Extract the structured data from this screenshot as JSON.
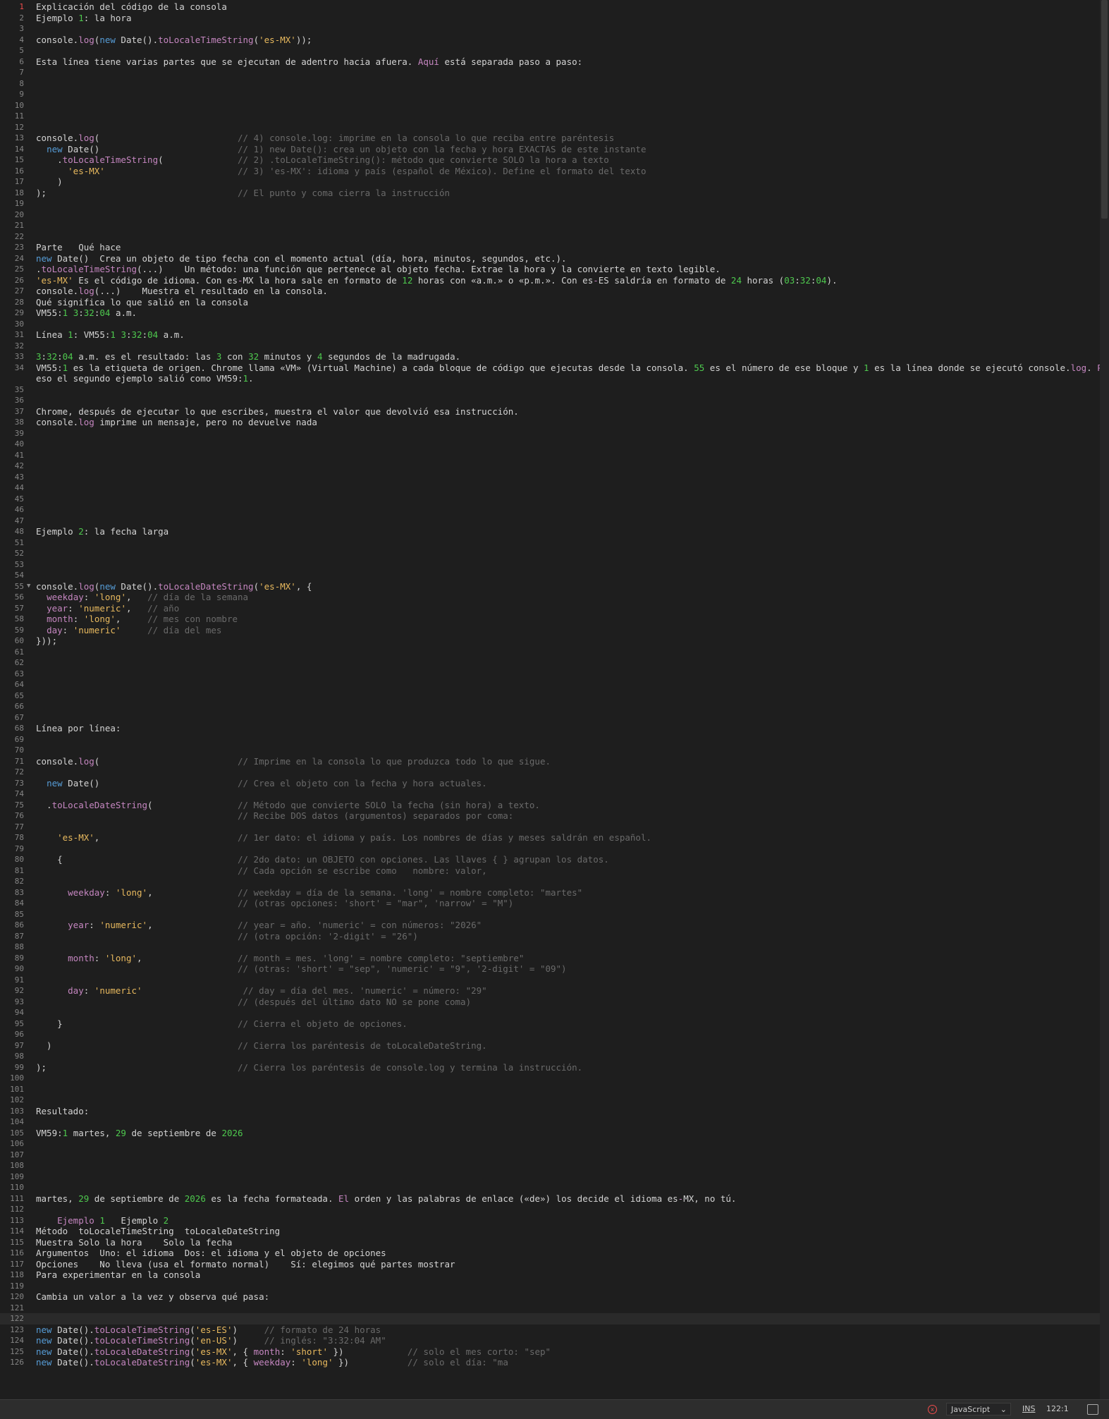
{
  "editor": {
    "cursor_line": 122,
    "lines": [
      {
        "n": "1",
        "html": "Explicación del código de la consola"
      },
      {
        "n": "2",
        "html": "Ejemplo <span class='num'>1</span>: la hora"
      },
      {
        "n": "3",
        "html": ""
      },
      {
        "n": "4",
        "html": "console.<span class='f'>log</span>(<span class='k'>new</span> Date().<span class='f'>toLocaleTimeString</span>(<span class='sq'>'es-MX'</span>));"
      },
      {
        "n": "5",
        "html": ""
      },
      {
        "n": "6",
        "html": "Esta línea tiene varias partes que se ejecutan de adentro hacia afuera. <span class='p'>Aquí</span> está separada paso a paso:"
      },
      {
        "n": "7",
        "html": ""
      },
      {
        "n": "8",
        "html": ""
      },
      {
        "n": "9",
        "html": ""
      },
      {
        "n": "10",
        "html": ""
      },
      {
        "n": "11",
        "html": ""
      },
      {
        "n": "12",
        "html": ""
      },
      {
        "n": "13",
        "html": "console.<span class='f'>log</span>(                          <span class='c'>// 4) console.log: imprime en la consola lo que reciba entre paréntesis</span>"
      },
      {
        "n": "14",
        "html": "  <span class='k'>new</span> Date()                          <span class='c'>// 1) new Date(): crea un objeto con la fecha y hora EXACTAS de este instante</span>"
      },
      {
        "n": "15",
        "html": "    .<span class='f'>toLocaleTimeString</span>(              <span class='c'>// 2) .toLocaleTimeString(): método que convierte SOLO la hora a texto</span>"
      },
      {
        "n": "16",
        "html": "      <span class='sq'>'es-MX'</span>                         <span class='c'>// 3) 'es-MX': idioma y país (español de México). Define el formato del texto</span>"
      },
      {
        "n": "17",
        "html": "    )"
      },
      {
        "n": "18",
        "html": ");                                    <span class='c'>// El punto y coma cierra la instrucción</span>"
      },
      {
        "n": "19",
        "html": ""
      },
      {
        "n": "20",
        "html": ""
      },
      {
        "n": "21",
        "html": ""
      },
      {
        "n": "22",
        "html": ""
      },
      {
        "n": "23",
        "html": "Parte   Qué hace"
      },
      {
        "n": "24",
        "html": "<span class='k'>new</span> Date()  Crea un objeto de tipo fecha con el momento actual (día, hora, minutos, segundos, etc.)."
      },
      {
        "n": "25",
        "html": ".<span class='f'>toLocaleTimeString</span>(...)    Un método: una función que pertenece al objeto fecha. Extrae la hora y la convierte en texto legible."
      },
      {
        "n": "26",
        "html": "<span class='sq'>'es-MX'</span> Es el código de idioma. Con es<span class='p'>-</span>MX la hora sale en formato de <span class='num'>12</span> horas con «a.m.» o «p.m.». Con es<span class='p'>-</span>ES saldría en formato de <span class='num'>24</span> horas (<span class='num'>03</span>:<span class='num'>32</span>:<span class='num'>04</span>)."
      },
      {
        "n": "27",
        "html": "console.<span class='f'>log</span>(...)    Muestra el resultado en la consola."
      },
      {
        "n": "28",
        "html": "Qué significa lo que salió en la consola"
      },
      {
        "n": "29",
        "html": "VM55:<span class='num'>1</span> <span class='num'>3</span>:<span class='num'>32</span>:<span class='num'>04</span> a.m."
      },
      {
        "n": "30",
        "html": ""
      },
      {
        "n": "31",
        "html": "Línea <span class='num'>1</span>: VM55:<span class='num'>1</span> <span class='num'>3</span>:<span class='num'>32</span>:<span class='num'>04</span> a.m."
      },
      {
        "n": "32",
        "html": ""
      },
      {
        "n": "33",
        "html": "<span class='num'>3</span>:<span class='num'>32</span>:<span class='num'>04</span> a.m. es el resultado: las <span class='num'>3</span> con <span class='num'>32</span> minutos y <span class='num'>4</span> segundos de la madrugada."
      },
      {
        "n": "34",
        "html": "VM55:<span class='num'>1</span> es la etiqueta de origen. Chrome llama «VM» (Virtual Machine) a cada bloque de código que ejecutas desde la consola. <span class='num'>55</span> es el número de ese bloque y <span class='num'>1</span> es la línea donde se ejecutó console.<span class='f'>log</span>. <span class='p'>Por</span>"
      },
      {
        "n": "",
        "html": "eso el segundo ejemplo salió como VM59:<span class='num'>1</span>."
      },
      {
        "n": "35",
        "html": ""
      },
      {
        "n": "36",
        "html": ""
      },
      {
        "n": "37",
        "html": "Chrome, después de ejecutar lo que escribes, muestra el valor que devolvió esa instrucción."
      },
      {
        "n": "38",
        "html": "console.<span class='f'>log</span> imprime un mensaje, pero no devuelve nada"
      },
      {
        "n": "39",
        "html": ""
      },
      {
        "n": "40",
        "html": ""
      },
      {
        "n": "41",
        "html": ""
      },
      {
        "n": "42",
        "html": ""
      },
      {
        "n": "43",
        "html": ""
      },
      {
        "n": "44",
        "html": ""
      },
      {
        "n": "45",
        "html": ""
      },
      {
        "n": "46",
        "html": ""
      },
      {
        "n": "47",
        "html": ""
      },
      {
        "n": "48",
        "html": "Ejemplo <span class='num'>2</span>: la fecha larga"
      },
      {
        "n": "51",
        "html": ""
      },
      {
        "n": "52",
        "html": ""
      },
      {
        "n": "53",
        "html": ""
      },
      {
        "n": "54",
        "html": ""
      },
      {
        "n": "55",
        "html": "console.<span class='f'>log</span>(<span class='k'>new</span> Date().<span class='f'>toLocaleDateString</span>(<span class='sq'>'es-MX'</span>, {"
      },
      {
        "n": "56",
        "html": "  <span class='f'>weekday</span>: <span class='sq'>'long'</span>,   <span class='c'>// día de la semana</span>"
      },
      {
        "n": "57",
        "html": "  <span class='f'>year</span>: <span class='sq'>'numeric'</span>,   <span class='c'>// año</span>"
      },
      {
        "n": "58",
        "html": "  <span class='f'>month</span>: <span class='sq'>'long'</span>,     <span class='c'>// mes con nombre</span>"
      },
      {
        "n": "59",
        "html": "  <span class='f'>day</span>: <span class='sq'>'numeric'</span>     <span class='c'>// día del mes</span>"
      },
      {
        "n": "60",
        "html": "}));"
      },
      {
        "n": "61",
        "html": ""
      },
      {
        "n": "62",
        "html": ""
      },
      {
        "n": "63",
        "html": ""
      },
      {
        "n": "64",
        "html": ""
      },
      {
        "n": "65",
        "html": ""
      },
      {
        "n": "66",
        "html": ""
      },
      {
        "n": "67",
        "html": ""
      },
      {
        "n": "68",
        "html": "Línea por línea:"
      },
      {
        "n": "69",
        "html": ""
      },
      {
        "n": "70",
        "html": ""
      },
      {
        "n": "71",
        "html": "console.<span class='f'>log</span>(                          <span class='c'>// Imprime en la consola lo que produzca todo lo que sigue.</span>"
      },
      {
        "n": "72",
        "html": ""
      },
      {
        "n": "73",
        "html": "  <span class='k'>new</span> Date()                          <span class='c'>// Crea el objeto con la fecha y hora actuales.</span>"
      },
      {
        "n": "74",
        "html": ""
      },
      {
        "n": "75",
        "html": "  .<span class='f'>toLocaleDateString</span>(                <span class='c'>// Método que convierte SOLO la fecha (sin hora) a texto.</span>"
      },
      {
        "n": "76",
        "html": "                                      <span class='c'>// Recibe DOS datos (argumentos) separados por coma:</span>"
      },
      {
        "n": "77",
        "html": ""
      },
      {
        "n": "78",
        "html": "    <span class='sq'>'es-MX'</span>,                          <span class='c'>// 1er dato: el idioma y país. Los nombres de días y meses saldrán en español.</span>"
      },
      {
        "n": "79",
        "html": ""
      },
      {
        "n": "80",
        "html": "    {                                 <span class='c'>// 2do dato: un OBJETO con opciones. Las llaves { } agrupan los datos.</span>"
      },
      {
        "n": "81",
        "html": "                                      <span class='c'>// Cada opción se escribe como   nombre: valor,</span>"
      },
      {
        "n": "82",
        "html": ""
      },
      {
        "n": "83",
        "html": "      <span class='f'>weekday</span>: <span class='sq'>'long'</span>,                <span class='c'>// weekday = día de la semana. 'long' = nombre completo: \"martes\"</span>"
      },
      {
        "n": "84",
        "html": "                                      <span class='c'>// (otras opciones: 'short' = \"mar\", 'narrow' = \"M\")</span>"
      },
      {
        "n": "85",
        "html": ""
      },
      {
        "n": "86",
        "html": "      <span class='f'>year</span>: <span class='sq'>'numeric'</span>,                <span class='c'>// year = año. 'numeric' = con números: \"2026\"</span>"
      },
      {
        "n": "87",
        "html": "                                      <span class='c'>// (otra opción: '2-digit' = \"26\")</span>"
      },
      {
        "n": "88",
        "html": ""
      },
      {
        "n": "89",
        "html": "      <span class='f'>month</span>: <span class='sq'>'long'</span>,                  <span class='c'>// month = mes. 'long' = nombre completo: \"septiembre\"</span>"
      },
      {
        "n": "90",
        "html": "                                      <span class='c'>// (otras: 'short' = \"sep\", 'numeric' = \"9\", '2-digit' = \"09\")</span>"
      },
      {
        "n": "91",
        "html": ""
      },
      {
        "n": "92",
        "html": "      <span class='f'>day</span>: <span class='sq'>'numeric'</span>                   <span class='c'>// day = día del mes. 'numeric' = número: \"29\"</span>"
      },
      {
        "n": "93",
        "html": "                                      <span class='c'>// (después del último dato NO se pone coma)</span>"
      },
      {
        "n": "94",
        "html": ""
      },
      {
        "n": "95",
        "html": "    }                                 <span class='c'>// Cierra el objeto de opciones.</span>"
      },
      {
        "n": "96",
        "html": ""
      },
      {
        "n": "97",
        "html": "  )                                   <span class='c'>// Cierra los paréntesis de toLocaleDateString.</span>"
      },
      {
        "n": "98",
        "html": ""
      },
      {
        "n": "99",
        "html": ");                                    <span class='c'>// Cierra los paréntesis de console.log y termina la instrucción.</span>"
      },
      {
        "n": "100",
        "html": ""
      },
      {
        "n": "101",
        "html": ""
      },
      {
        "n": "102",
        "html": ""
      },
      {
        "n": "103",
        "html": "Resultado:"
      },
      {
        "n": "104",
        "html": ""
      },
      {
        "n": "105",
        "html": "VM59:<span class='num'>1</span> martes, <span class='num'>29</span> de septiembre de <span class='num'>2026</span>"
      },
      {
        "n": "106",
        "html": ""
      },
      {
        "n": "107",
        "html": ""
      },
      {
        "n": "108",
        "html": ""
      },
      {
        "n": "109",
        "html": ""
      },
      {
        "n": "110",
        "html": ""
      },
      {
        "n": "111",
        "html": "martes, <span class='num'>29</span> de septiembre de <span class='num'>2026</span> es la fecha formateada. <span class='p'>El</span> orden y las palabras de enlace («de») los decide el idioma es<span class='p'>-</span>MX, no tú."
      },
      {
        "n": "112",
        "html": ""
      },
      {
        "n": "113",
        "html": "    <span class='f'>Ejemplo</span> <span class='num'>1</span>   Ejemplo <span class='num'>2</span>"
      },
      {
        "n": "114",
        "html": "Método  toLocaleTimeString  toLocaleDateString"
      },
      {
        "n": "115",
        "html": "Muestra Solo la hora    Solo la fecha"
      },
      {
        "n": "116",
        "html": "Argumentos  Uno: el idioma  Dos: el idioma y el objeto de opciones"
      },
      {
        "n": "117",
        "html": "Opciones    No lleva (usa el formato normal)    Sí: elegimos qué partes mostrar"
      },
      {
        "n": "118",
        "html": "Para experimentar en la consola"
      },
      {
        "n": "119",
        "html": ""
      },
      {
        "n": "120",
        "html": "Cambia un valor a la vez y observa qué pasa:"
      },
      {
        "n": "121",
        "html": ""
      },
      {
        "n": "122",
        "html": ""
      },
      {
        "n": "123",
        "html": "<span class='k'>new</span> Date().<span class='f'>toLocaleTimeString</span>(<span class='sq'>'es-ES'</span>)     <span class='c'>// formato de 24 horas</span>"
      },
      {
        "n": "124",
        "html": "<span class='k'>new</span> Date().<span class='f'>toLocaleTimeString</span>(<span class='sq'>'en-US'</span>)     <span class='c'>// inglés: \"3:32:04 AM\"</span>"
      },
      {
        "n": "125",
        "html": "<span class='k'>new</span> Date().<span class='f'>toLocaleDateString</span>(<span class='sq'>'es-MX'</span>, { <span class='f'>month</span>: <span class='sq'>'short'</span> })            <span class='c'>// solo el mes corto: \"sep\"</span>"
      },
      {
        "n": "126",
        "html": "<span class='k'>new</span> Date().<span class='f'>toLocaleDateString</span>(<span class='sq'>'es-MX'</span>, { <span class='f'>weekday</span>: <span class='sq'>'long'</span> })           <span class='c'>// solo el día: \"ma</span>"
      }
    ]
  },
  "statusbar": {
    "error_icon": "x",
    "language": "JavaScript",
    "mode": "INS",
    "position": "122:1",
    "layout_icon": "layout-icon"
  },
  "colors": {
    "background": "#1e1e1e",
    "keyword": "#569cd6",
    "function": "#c586c0",
    "string": "#e8b95e",
    "number": "#4ec94e",
    "comment": "#6a6a6a",
    "active_line_number": "#f14c4c"
  }
}
